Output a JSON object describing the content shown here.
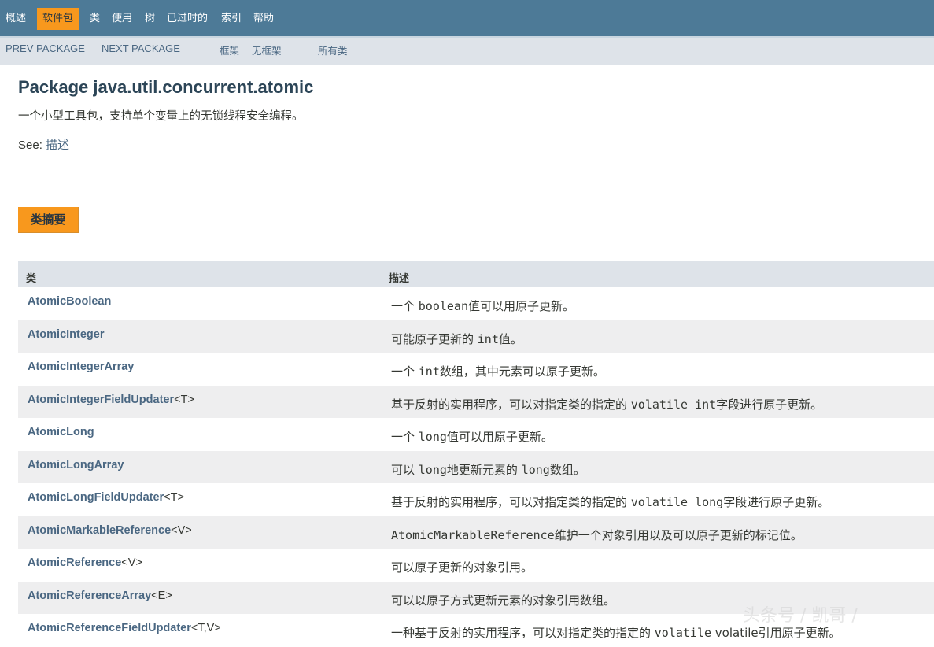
{
  "topnav": {
    "items": [
      "概述",
      "软件包",
      "类",
      "使用",
      "树",
      "已过时的",
      "索引",
      "帮助"
    ],
    "active": "软件包"
  },
  "subnav": {
    "prev": "PREV PACKAGE",
    "next": "NEXT PACKAGE",
    "frames": "框架",
    "no_frames": "无框架",
    "all_classes": "所有类"
  },
  "package": {
    "title": "Package java.util.concurrent.atomic",
    "description": "一个小型工具包，支持单个变量上的无锁线程安全编程。",
    "see_label": "See: ",
    "see_link": "描述"
  },
  "summary": {
    "tab": "类摘要",
    "col_class": "类",
    "col_desc": "描述",
    "rows": [
      {
        "name": "AtomicBoolean",
        "generic": "",
        "desc": [
          "一个 ",
          "boolean",
          "值可以用原子更新。"
        ]
      },
      {
        "name": "AtomicInteger",
        "generic": "",
        "desc": [
          "可能原子更新的 ",
          "int",
          "值。"
        ]
      },
      {
        "name": "AtomicIntegerArray",
        "generic": "",
        "desc": [
          "一个 ",
          "int",
          "数组，其中元素可以原子更新。"
        ]
      },
      {
        "name": "AtomicIntegerFieldUpdater",
        "generic": "<T>",
        "desc": [
          "基于反射的实用程序，可以对指定类的指定的 ",
          "volatile int",
          "字段进行原子更新。"
        ]
      },
      {
        "name": "AtomicLong",
        "generic": "",
        "desc": [
          "一个 ",
          "long",
          "值可以用原子更新。"
        ]
      },
      {
        "name": "AtomicLongArray",
        "generic": "",
        "desc": [
          "可以 ",
          "long",
          "地更新元素的 ",
          "long",
          "数组。"
        ]
      },
      {
        "name": "AtomicLongFieldUpdater",
        "generic": "<T>",
        "desc": [
          "基于反射的实用程序，可以对指定类的指定的 ",
          "volatile long",
          "字段进行原子更新。"
        ]
      },
      {
        "name": "AtomicMarkableReference",
        "generic": "<V>",
        "desc": [
          "",
          "AtomicMarkableReference",
          "维护一个对象引用以及可以原子更新的标记位。"
        ]
      },
      {
        "name": "AtomicReference",
        "generic": "<V>",
        "desc": [
          "可以原子更新的对象引用。"
        ]
      },
      {
        "name": "AtomicReferenceArray",
        "generic": "<E>",
        "desc": [
          "可以以原子方式更新元素的对象引用数组。"
        ]
      },
      {
        "name": "AtomicReferenceFieldUpdater",
        "generic": "<T,V>",
        "desc": [
          "一种基于反射的实用程序，可以对指定类的指定的 ",
          "volatile",
          " volatile引用原子更新。"
        ]
      }
    ]
  },
  "watermark": "头条号 / 凯哥 /"
}
